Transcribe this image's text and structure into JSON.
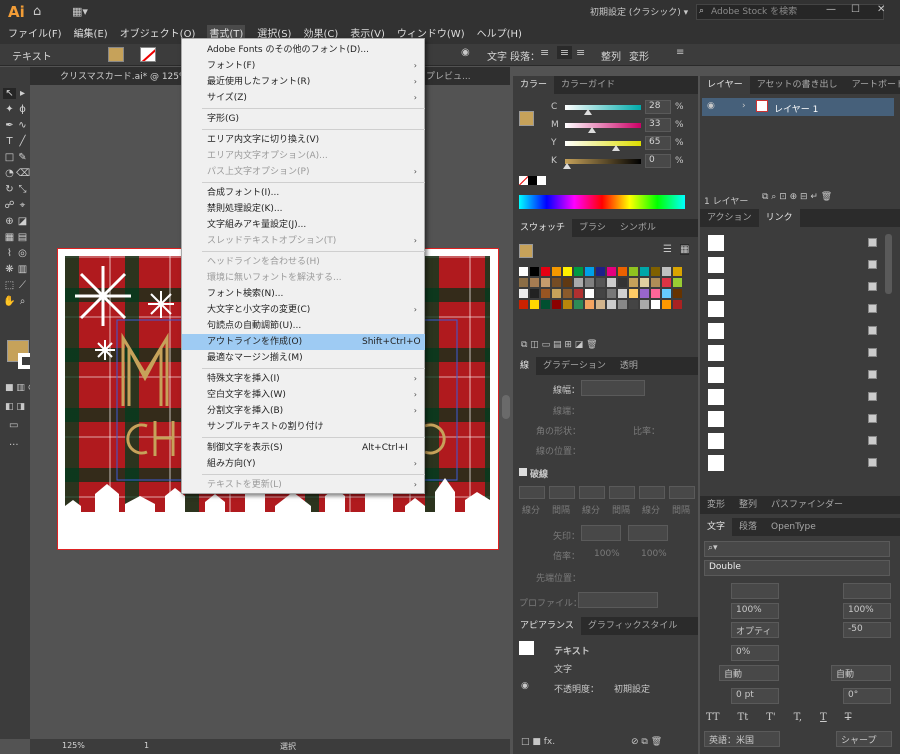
{
  "app": {
    "logo": "Ai",
    "workspace": "初期設定 (クラシック)",
    "search_placeholder": "Adobe Stock を検索"
  },
  "menubar": [
    "ファイル(F)",
    "編集(E)",
    "オブジェクト(O)",
    "書式(T)",
    "選択(S)",
    "効果(C)",
    "表示(V)",
    "ウィンドウ(W)",
    "ヘルプ(H)"
  ],
  "control": {
    "mode": "テキスト",
    "char_label": "文字",
    "para_label": "段落：",
    "align_label": "整列",
    "transform_label": "変形"
  },
  "doc": {
    "tab": "クリスマスカード.ai* @ 125% (CMY",
    "tab_more": "プレビュ..."
  },
  "menu": {
    "items": [
      {
        "label": "Adobe Fonts のその他のフォント(D)...",
        "state": "normal"
      },
      {
        "label": "フォント(F)",
        "state": "normal",
        "sub": true
      },
      {
        "label": "最近使用したフォント(R)",
        "state": "normal",
        "sub": true
      },
      {
        "label": "サイズ(Z)",
        "state": "normal",
        "sub": true
      },
      {
        "sep": true
      },
      {
        "label": "字形(G)",
        "state": "normal"
      },
      {
        "sep": true
      },
      {
        "label": "エリア内文字に切り換え(V)",
        "state": "normal"
      },
      {
        "label": "エリア内文字オプション(A)...",
        "state": "disabled"
      },
      {
        "label": "パス上文字オプション(P)",
        "state": "disabled",
        "sub": true
      },
      {
        "sep": true
      },
      {
        "label": "合成フォント(I)...",
        "state": "normal"
      },
      {
        "label": "禁則処理設定(K)...",
        "state": "normal"
      },
      {
        "label": "文字組みアキ量設定(J)...",
        "state": "normal"
      },
      {
        "label": "スレッドテキストオプション(T)",
        "state": "disabled",
        "sub": true
      },
      {
        "sep": true
      },
      {
        "label": "ヘッドラインを合わせる(H)",
        "state": "disabled"
      },
      {
        "label": "環境に無いフォントを解決する...",
        "state": "disabled"
      },
      {
        "label": "フォント検索(N)...",
        "state": "normal"
      },
      {
        "label": "大文字と小文字の変更(C)",
        "state": "normal",
        "sub": true
      },
      {
        "label": "句読点の自動調節(U)...",
        "state": "normal"
      },
      {
        "label": "アウトラインを作成(O)",
        "state": "highlight",
        "shortcut": "Shift+Ctrl+O"
      },
      {
        "label": "最適なマージン揃え(M)",
        "state": "normal"
      },
      {
        "sep": true
      },
      {
        "label": "特殊文字を挿入(I)",
        "state": "normal",
        "sub": true
      },
      {
        "label": "空白文字を挿入(W)",
        "state": "normal",
        "sub": true
      },
      {
        "label": "分割文字を挿入(B)",
        "state": "normal",
        "sub": true
      },
      {
        "label": "サンプルテキストの割り付け",
        "state": "normal"
      },
      {
        "sep": true
      },
      {
        "label": "制御文字を表示(S)",
        "state": "normal",
        "shortcut": "Alt+Ctrl+I"
      },
      {
        "label": "組み方向(Y)",
        "state": "normal",
        "sub": true
      },
      {
        "sep": true
      },
      {
        "label": "テキストを更新(L)",
        "state": "disabled",
        "sub": true
      }
    ]
  },
  "color_panel": {
    "tabs": [
      "カラー",
      "カラーガイド"
    ],
    "channels": [
      {
        "name": "C",
        "value": "28"
      },
      {
        "name": "M",
        "value": "33"
      },
      {
        "name": "Y",
        "value": "65"
      },
      {
        "name": "K",
        "value": "0"
      }
    ],
    "unit": "%"
  },
  "swatch_panel": {
    "tabs": [
      "スウォッチ",
      "ブラシ",
      "シンボル"
    ]
  },
  "stroke_panel": {
    "tabs": [
      "線",
      "グラデーション",
      "透明"
    ],
    "weight_label": "線幅：",
    "cap_label": "線端：",
    "corner_label": "角の形状：",
    "limit_label": "比率：",
    "align_label": "線の位置：",
    "dashed_label": "破線",
    "dash_labels": [
      "線分",
      "間隔",
      "線分",
      "間隔",
      "線分",
      "間隔"
    ],
    "arrow_label": "矢印：",
    "scale_label": "倍率：",
    "scale_a": "100%",
    "scale_b": "100%",
    "align_arrow_label": "先端位置：",
    "profile_label": "プロファイル："
  },
  "appearance": {
    "tabs": [
      "アピアランス",
      "グラフィックスタイル"
    ],
    "title": "テキスト",
    "row1": "文字",
    "opacity_label": "不透明度：",
    "opacity_value": "初期設定"
  },
  "layers": {
    "tabs": [
      "レイヤー",
      "アセットの書き出し",
      "アートボード"
    ],
    "layer_name": "レイヤー 1",
    "count": "1 レイヤー"
  },
  "links": {
    "tabs": [
      "アクション",
      "リンク"
    ]
  },
  "transform_tabs": [
    "変形",
    "整列",
    "パスファインダー"
  ],
  "character": {
    "tabs": [
      "文字",
      "段落",
      "OpenType"
    ],
    "search_placeholder": "",
    "font_style": "Double",
    "vscale": "100%",
    "hscale": "100%",
    "tracking_type": "オプティ",
    "tracking": "-50",
    "baseline": "0%",
    "auto1": "自動",
    "auto2": "自動",
    "pt": "0 pt",
    "rotate": "0°",
    "tt": [
      "TT",
      "Tt",
      "T'",
      "T,",
      "T",
      "T"
    ],
    "language": "英語：米国",
    "aa": "シャープ"
  },
  "status": {
    "zoom": "125%",
    "page": "1",
    "tool": "選択"
  },
  "colors": {
    "accent": "#c6a25a",
    "highlight": "#9ecbf3",
    "menu_bg": "#f0f0f0"
  }
}
